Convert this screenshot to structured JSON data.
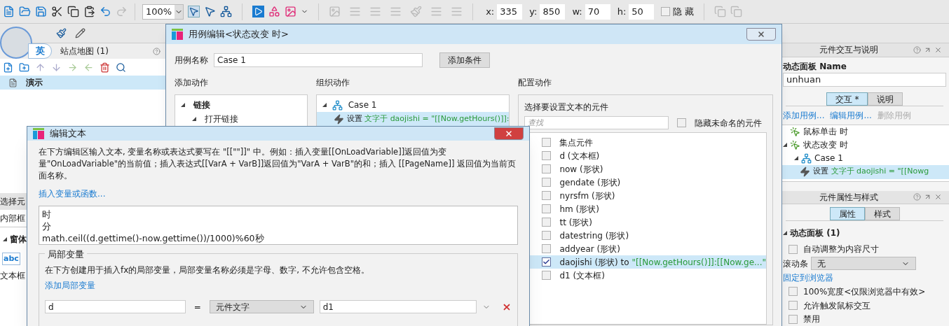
{
  "toolbar": {
    "zoom": "100%",
    "fields": [
      {
        "label": "x:",
        "value": "335"
      },
      {
        "label": "y:",
        "value": "850"
      },
      {
        "label": "w:",
        "value": "70"
      },
      {
        "label": "h:",
        "value": "50"
      }
    ],
    "hide": {
      "label": "隐 藏",
      "checked": false
    }
  },
  "ime": {
    "label": "英"
  },
  "left_panel": {
    "title": "站点地图 (1)",
    "pages": [
      {
        "label": "演示",
        "selected": true
      }
    ],
    "fragments": {
      "select_widget": "选择元",
      "inner": "内部框",
      "section": "窗体",
      "sample": "abc",
      "textbox": "文本框"
    }
  },
  "right_panel": {
    "interaction": {
      "title": "元件交互与说明",
      "name_label": "动态面板 Name",
      "name_value": "unhuan",
      "tabs": [
        {
          "label": "交互 *",
          "selected": true
        },
        {
          "label": "说明",
          "selected": false
        }
      ],
      "links": [
        {
          "label": "添加用例...",
          "disabled": false
        },
        {
          "label": "编辑用例...",
          "disabled": false
        },
        {
          "label": "删除用例",
          "disabled": true
        }
      ],
      "events": [
        {
          "label": "鼠标单击 时",
          "expanded": false
        },
        {
          "label": "状态改变 时",
          "expanded": true,
          "children": [
            {
              "label": "Case 1",
              "expanded": true,
              "children": [
                {
                  "action": "设置",
                  "detail": "文字于 daojishi = \"[[Nowg",
                  "selected": true
                }
              ]
            }
          ]
        }
      ]
    },
    "properties": {
      "title": "元件属性与样式",
      "tabs": [
        {
          "label": "属性",
          "selected": true
        },
        {
          "label": "样式",
          "selected": false
        }
      ],
      "section": "动态面板 (1)",
      "rows": [
        {
          "kind": "checkbox",
          "label": "自动调整为内容尺寸",
          "checked": false
        },
        {
          "kind": "select",
          "label": "滚动条",
          "value": "无"
        },
        {
          "kind": "link",
          "label": "固定到浏览器"
        },
        {
          "kind": "checkbox",
          "label": "100%宽度<仅限浏览器中有效>",
          "checked": false
        },
        {
          "kind": "checkbox",
          "label": "允许触发鼠标交互",
          "checked": false
        },
        {
          "kind": "checkbox",
          "label": "禁用",
          "checked": false
        }
      ]
    }
  },
  "case_dialog": {
    "title": "用例编辑<状态改变 时>",
    "case_name_label": "用例名称",
    "case_name": "Case 1",
    "add_condition": "添加条件",
    "add_actions": {
      "title": "添加动作",
      "tree": [
        {
          "label": "链接",
          "expanded": true,
          "children": [
            {
              "label": "打开链接",
              "expanded": true
            }
          ]
        }
      ]
    },
    "organize": {
      "title": "组织动作",
      "case": "Case 1",
      "actions": [
        {
          "action": "设置",
          "detail": "文字于 daojishi = \"[[Now.getHours()]]:",
          "selected": true
        }
      ]
    },
    "configure": {
      "title": "配置动作",
      "subtitle": "选择要设置文本的元件",
      "search_placeholder": "查找",
      "hide_unnamed": {
        "label": "隐藏未命名的元件",
        "checked": false
      },
      "widgets": [
        {
          "label": "集点元件",
          "checked": false,
          "selected": false
        },
        {
          "label": "d (文本框)",
          "checked": false,
          "selected": false
        },
        {
          "label": "now (形状)",
          "checked": false,
          "selected": false
        },
        {
          "label": "gendate (形状)",
          "checked": false,
          "selected": false
        },
        {
          "label": "nyrsfm (形状)",
          "checked": false,
          "selected": false
        },
        {
          "label": "hm (形状)",
          "checked": false,
          "selected": false
        },
        {
          "label": "tt (形状)",
          "checked": false,
          "selected": false
        },
        {
          "label": "datestring (形状)",
          "checked": false,
          "selected": false
        },
        {
          "label": "addyear (形状)",
          "checked": false,
          "selected": false
        },
        {
          "label": "daojishi (形状) to",
          "value": "\"[[Now.getHours()]]:[[Now.ge...\"",
          "checked": true,
          "selected": true
        },
        {
          "label": "d1 (文本框)",
          "checked": false,
          "selected": false
        }
      ]
    }
  },
  "text_dialog": {
    "title": "编辑文本",
    "description": "在下方编辑区输入文本, 变量名称或表达式要写在 \"[[\"\"]]\" 中。例如：插入变量[[OnLoadVariable]]返回值为变量\"OnLoadVariable\"的当前值；插入表达式[[VarA + VarB]]返回值为\"VarA + VarB\"的和；插入 [[PageName]] 返回值为当前页面名称。",
    "insert_link": "插入变量或函数...",
    "lines": [
      "时",
      "分",
      "math.ceil((d.gettime()-now.gettime())/1000)%60秒"
    ],
    "locals": {
      "title": "局部变量",
      "description": "在下方创建用于插入fx的局部变量，局部变量名称必须是字母、数字, 不允许包含空格。",
      "add_link": "添加局部变量",
      "rows": [
        {
          "name": "d",
          "equals": "=",
          "type": "元件文字",
          "value": "d1"
        }
      ]
    }
  }
}
